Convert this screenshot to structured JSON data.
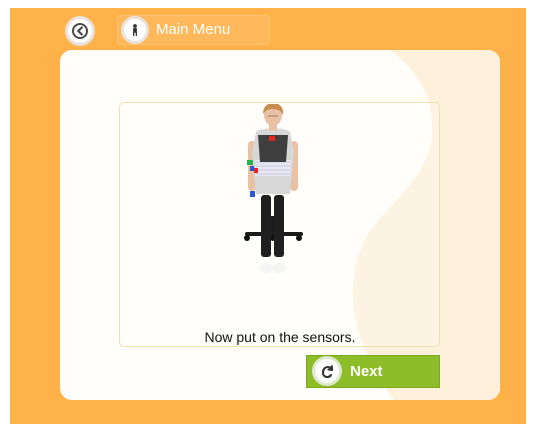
{
  "header": {
    "back_icon": "chevron-left-icon",
    "menu_icon": "person-icon",
    "menu_label": "Main Menu"
  },
  "content": {
    "instruction": "Now put on the sensors.",
    "illustration": "seated-person-with-sensors"
  },
  "footer": {
    "next_icon": "refresh-icon",
    "next_label": "Next"
  },
  "colors": {
    "frame": "#ffb24a",
    "panel": "#fffefb",
    "next_button": "#8dbd28",
    "text": "#111111"
  }
}
